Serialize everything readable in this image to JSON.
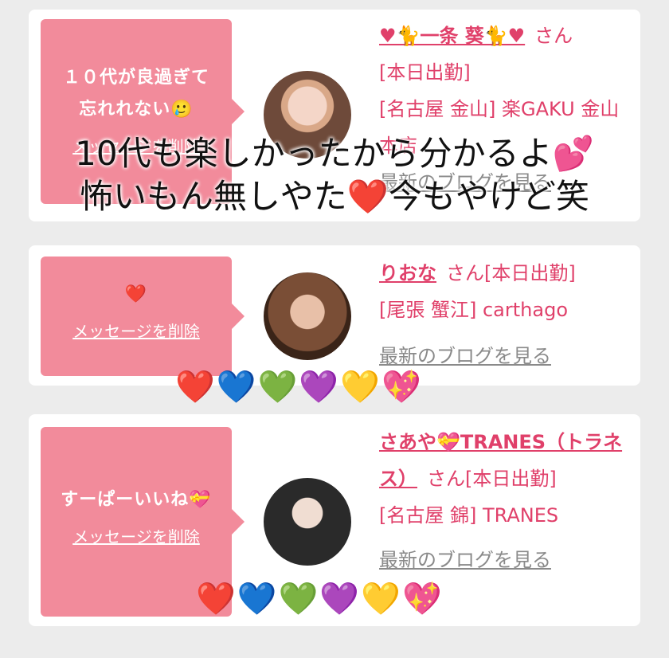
{
  "cards": [
    {
      "message": "１０代が良過ぎて忘れれない🥲",
      "delete_label": "メッセージを削除",
      "name": "♥🐈一条 葵🐈♥",
      "san": "さん",
      "status": "[本日出勤]",
      "location": "[名古屋 金山] 楽GAKU 金山本店",
      "blog_link": "最新のブログを見る"
    },
    {
      "message": "❤️",
      "delete_label": "メッセージを削除",
      "name": "りおな",
      "san": "さん[本日出勤]",
      "location": "[尾張 蟹江] carthago",
      "blog_link": "最新のブログを見る"
    },
    {
      "message": "すーぱーいいね💝",
      "delete_label": "メッセージを削除",
      "name": "さあや💝TRANES（トラネス）",
      "san": "さん[本日出勤]",
      "location": "[名古屋 錦] TRANES",
      "blog_link": "最新のブログを見る"
    }
  ],
  "overlay": {
    "line1": "10代も楽しかったから分かるよ💕",
    "line2": "怖いもん無しやた❤️今もやけど笑"
  },
  "hearts_row1": "❤️💙💚💜💛💖",
  "hearts_row2": "❤️💙💚💜💛💖",
  "colors": {
    "accent": "#e0406a",
    "bubble": "#f28b9b",
    "background": "#ececec"
  }
}
